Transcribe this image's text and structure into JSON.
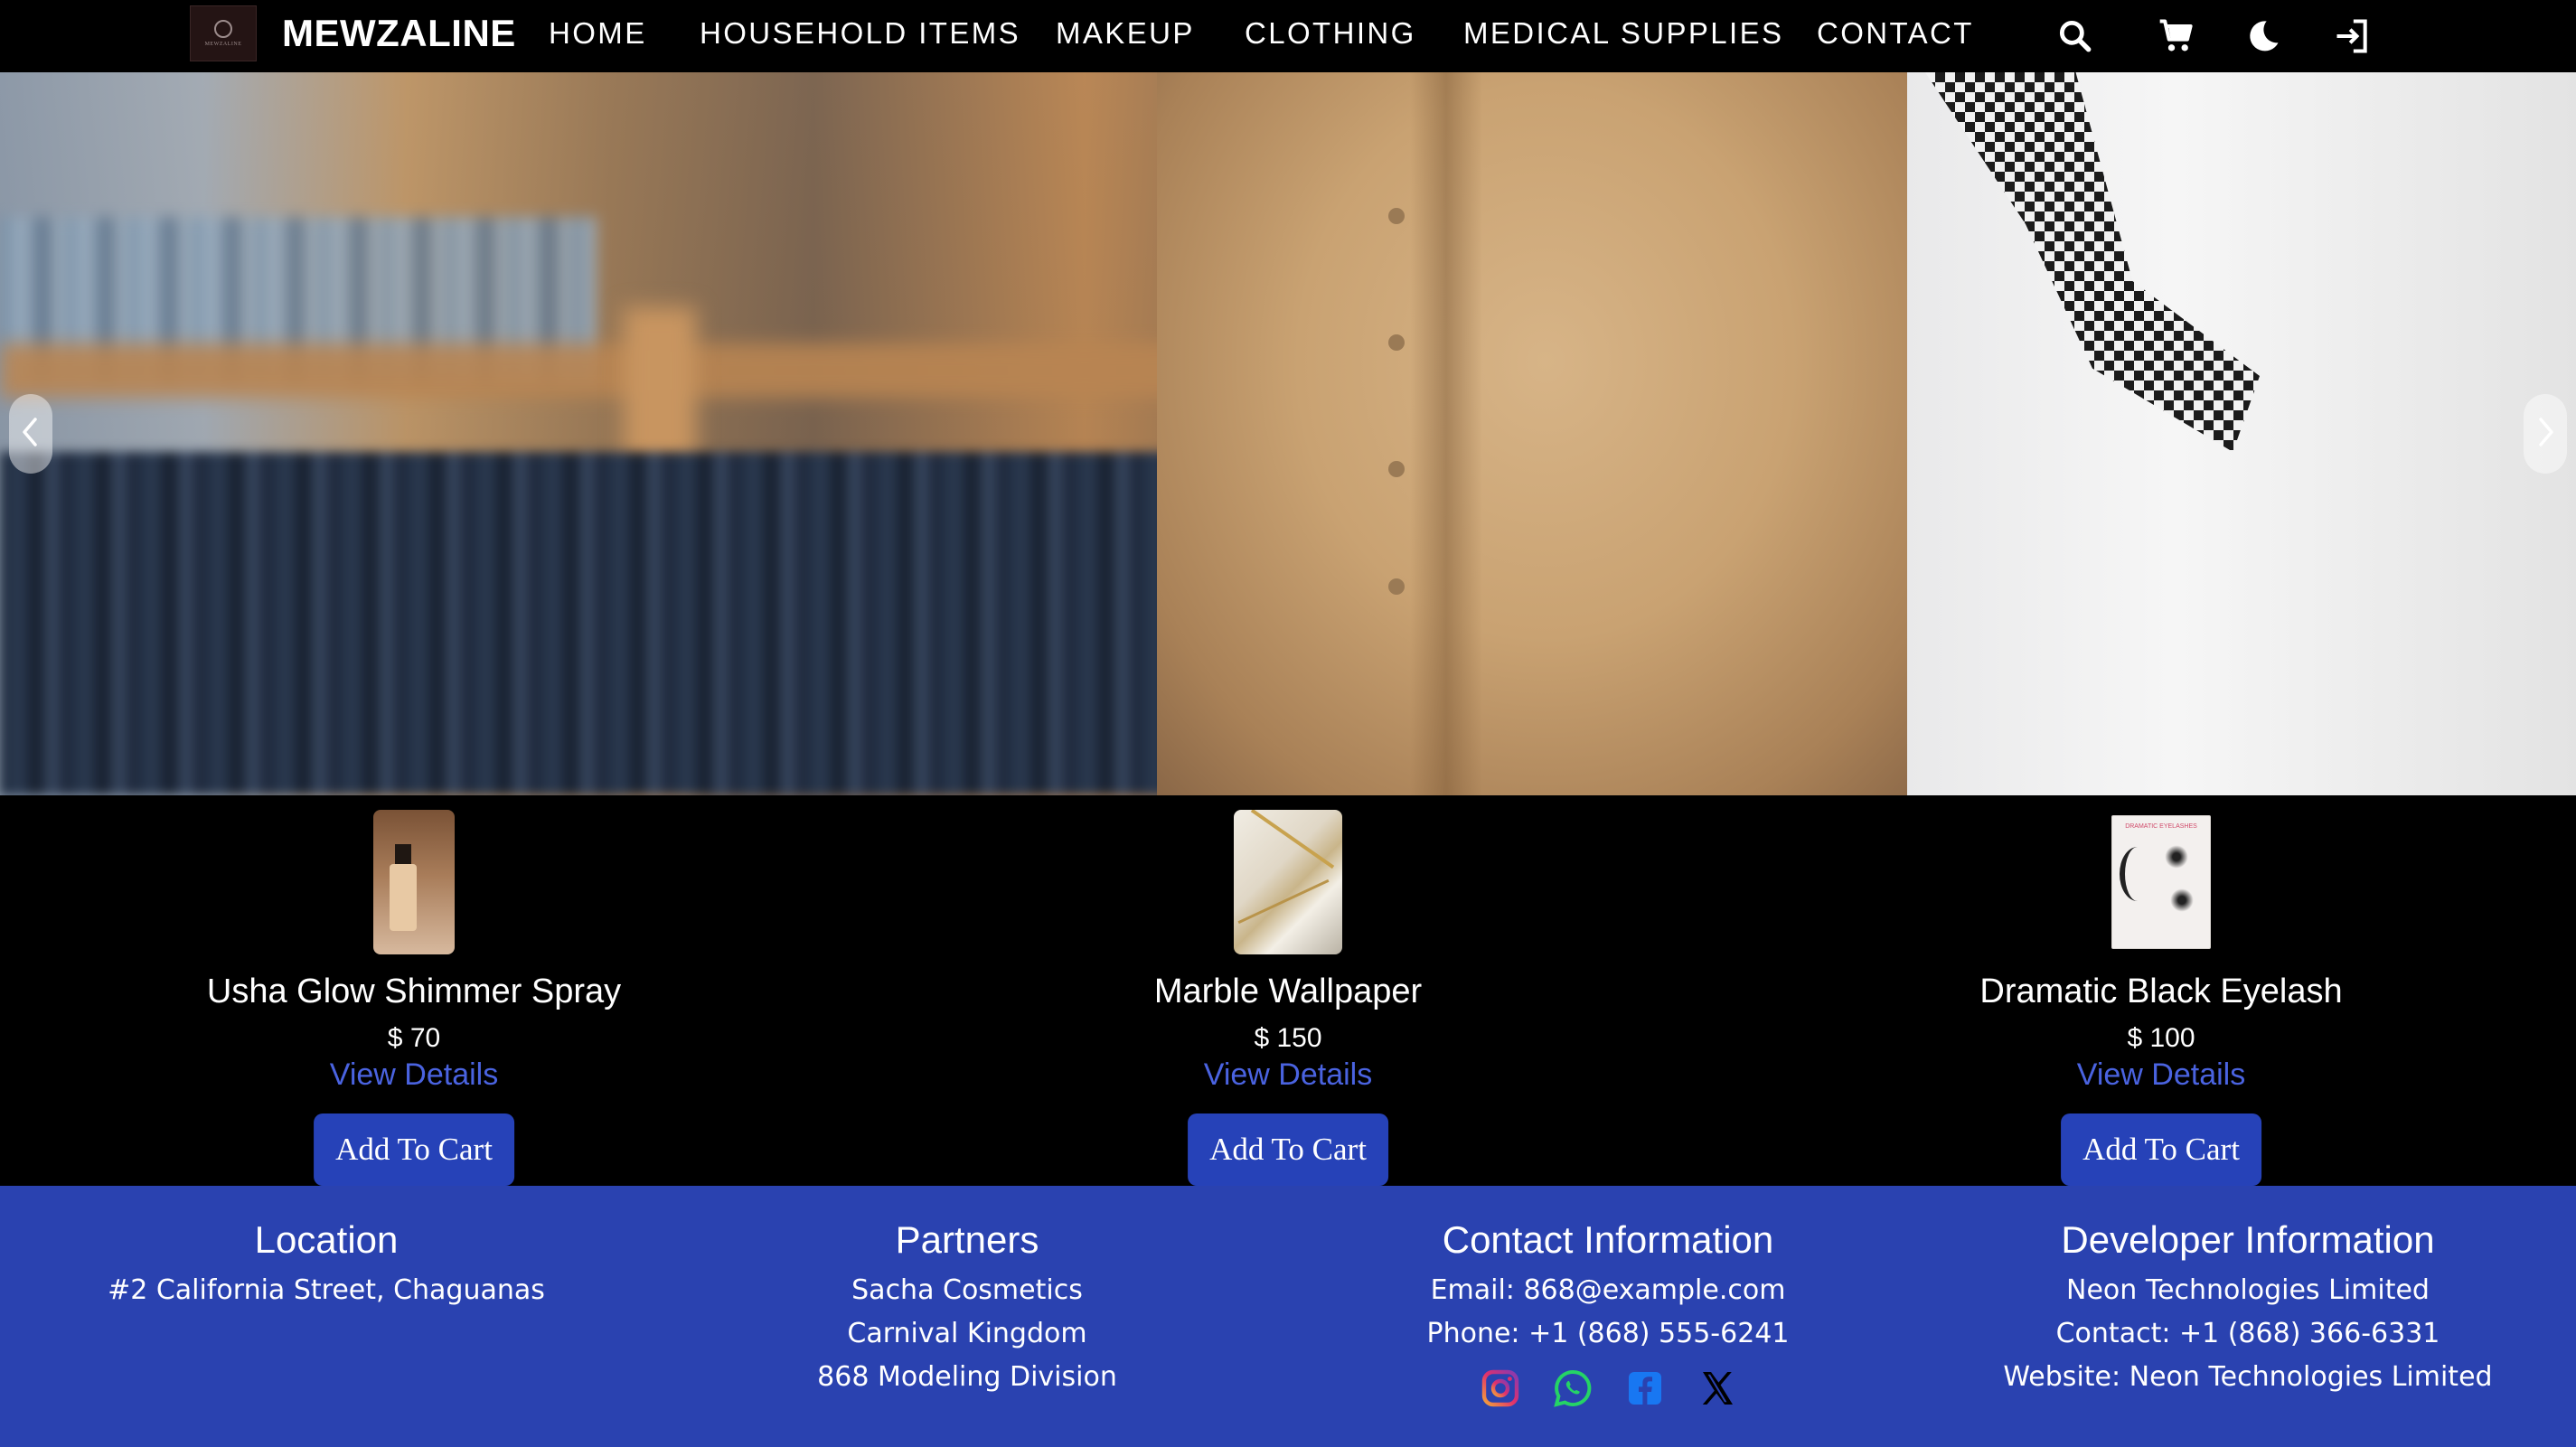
{
  "brand": {
    "name": "MEWZALINE",
    "logo_text": "MEWZALINE"
  },
  "nav": {
    "links": [
      "HOME",
      "HOUSEHOLD ITEMS",
      "MAKEUP",
      "CLOTHING",
      "MEDICAL SUPPLIES",
      "CONTACT"
    ],
    "icons": [
      "search-icon",
      "cart-icon",
      "dark-mode-icon",
      "login-icon"
    ]
  },
  "hero": {
    "prev_icon": "chevron-left-icon",
    "next_icon": "chevron-right-icon"
  },
  "products": [
    {
      "name": "Usha Glow Shimmer Spray",
      "price": "$ 70",
      "link": "View Details",
      "button": "Add To Cart"
    },
    {
      "name": "Marble Wallpaper",
      "price": "$ 150",
      "link": "View Details",
      "button": "Add To Cart"
    },
    {
      "name": "Dramatic Black Eyelash",
      "price": "$ 100",
      "link": "View Details",
      "button": "Add To Cart",
      "image_text": "DRAMATIC EYELASHES"
    }
  ],
  "footer": {
    "location": {
      "title": "Location",
      "lines": [
        "#2 California Street, Chaguanas"
      ]
    },
    "partners": {
      "title": "Partners",
      "lines": [
        "Sacha Cosmetics",
        "Carnival Kingdom",
        "868 Modeling Division"
      ]
    },
    "contact": {
      "title": "Contact Information",
      "lines": [
        "Email: 868@example.com",
        "Phone: +1 (868) 555-6241"
      ]
    },
    "developer": {
      "title": "Developer Information",
      "lines": [
        "Neon Technologies Limited",
        "Contact: +1 (868) 366-6331",
        "Website: Neon Technologies Limited"
      ]
    },
    "social": [
      "instagram-icon",
      "whatsapp-icon",
      "facebook-icon",
      "x-icon"
    ]
  },
  "colors": {
    "accent": "#2a42b0",
    "button": "#2642b8",
    "link": "#4a63e0",
    "background": "#000000"
  }
}
